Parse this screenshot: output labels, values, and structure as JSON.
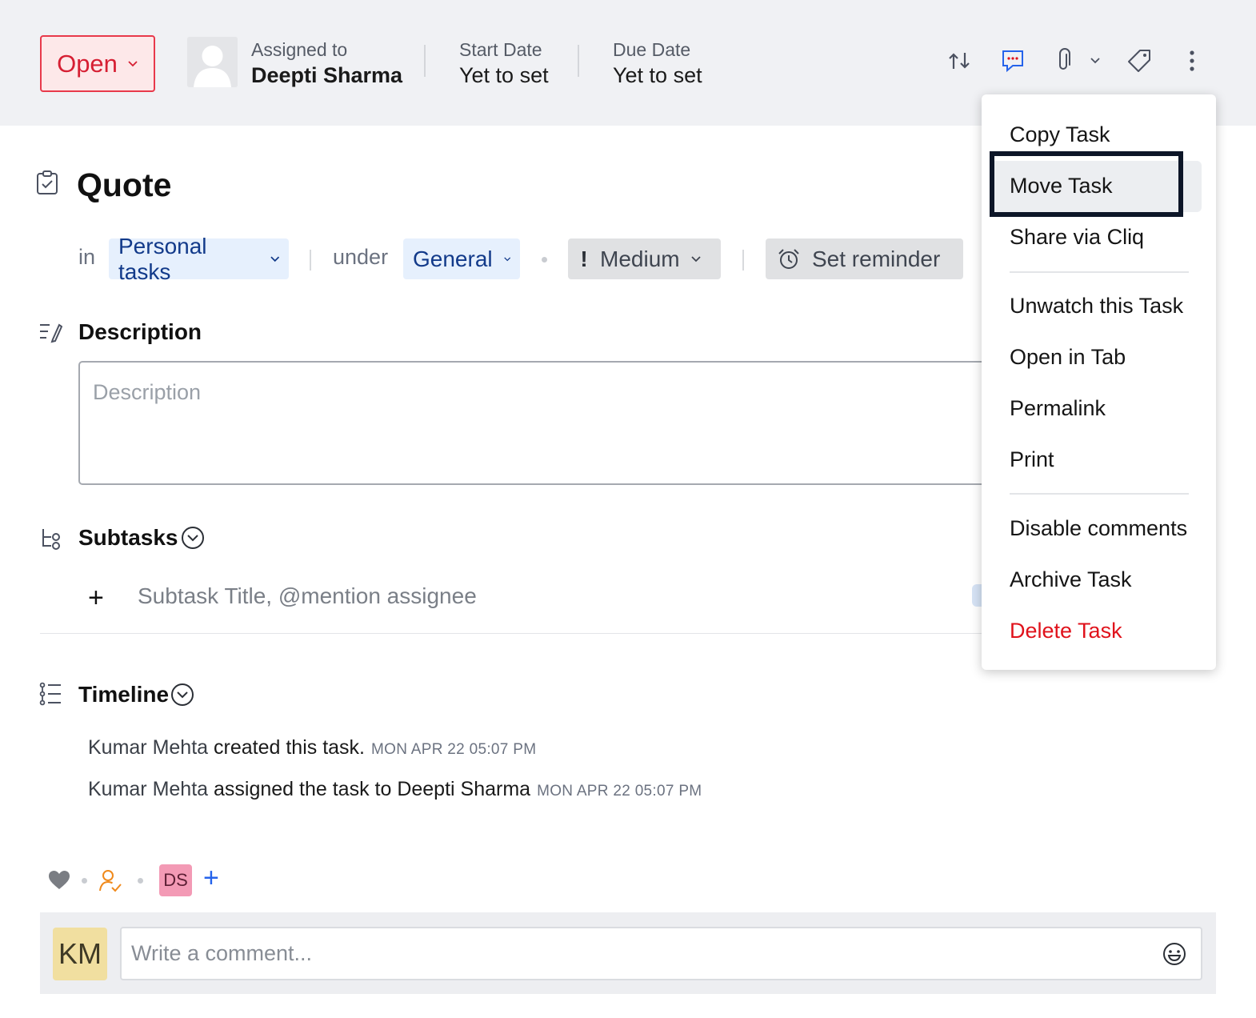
{
  "header": {
    "status": "Open",
    "assigned_label": "Assigned to",
    "assigned_value": "Deepti Sharma",
    "start_label": "Start Date",
    "start_value": "Yet to set",
    "due_label": "Due Date",
    "due_value": "Yet to set",
    "toolbar_icons": [
      "swap-arrows-icon",
      "comment-chat-icon",
      "paperclip-icon",
      "chevron-down-icon",
      "tag-icon",
      "more-vertical-icon"
    ]
  },
  "task": {
    "title": "Quote",
    "in_label": "in",
    "project": "Personal tasks",
    "under_label": "under",
    "tasklist": "General",
    "priority": "Medium",
    "reminder": "Set reminder"
  },
  "description": {
    "heading": "Description",
    "placeholder": "Description"
  },
  "subtasks": {
    "heading": "Subtasks",
    "add_symbol": "+",
    "placeholder": "Subtask Title, @mention assignee"
  },
  "timeline": {
    "heading": "Timeline",
    "entries": [
      {
        "who": "Kumar Mehta",
        "action": " created this task.",
        "time": "MON APR 22 05:07 PM"
      },
      {
        "who": "Kumar Mehta",
        "action": " assigned the task to Deepti Sharma",
        "time": "MON APR 22 05:07 PM"
      }
    ]
  },
  "followers": {
    "badge": "DS",
    "add_symbol": "+"
  },
  "comment": {
    "avatar": "KM",
    "placeholder": "Write a comment..."
  },
  "menu": {
    "items": [
      {
        "label": "Copy Task"
      },
      {
        "label": "Move Task"
      },
      {
        "label": "Share via Cliq"
      },
      {
        "label": "Unwatch this Task"
      },
      {
        "label": "Open in Tab"
      },
      {
        "label": "Permalink"
      },
      {
        "label": "Print"
      },
      {
        "label": "Disable comments"
      },
      {
        "label": "Archive Task"
      },
      {
        "label": "Delete Task"
      }
    ],
    "highlighted": "Move Task"
  },
  "colors": {
    "status_red": "#d61f33",
    "link_blue": "#123a8a",
    "danger": "#e0121b",
    "accent_blue": "#2563eb"
  }
}
